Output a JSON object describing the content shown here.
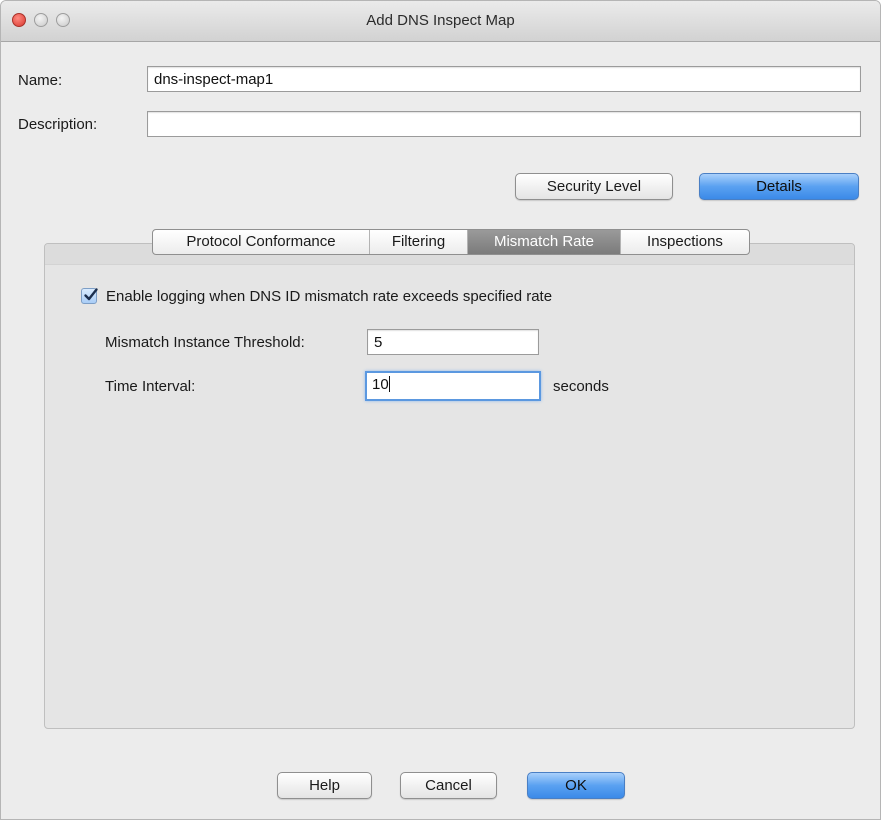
{
  "window": {
    "title": "Add DNS Inspect Map"
  },
  "form": {
    "name_label": "Name:",
    "name_value": "dns-inspect-map1",
    "description_label": "Description:",
    "description_value": ""
  },
  "view_buttons": {
    "security_level": "Security Level",
    "details": "Details"
  },
  "tabs": [
    {
      "label": "Protocol Conformance"
    },
    {
      "label": "Filtering"
    },
    {
      "label": "Mismatch Rate",
      "active": true
    },
    {
      "label": "Inspections"
    }
  ],
  "mismatch": {
    "enable_logging_label": "Enable logging when DNS ID mismatch rate exceeds specified rate",
    "enable_logging_checked": true,
    "threshold_label": "Mismatch Instance Threshold:",
    "threshold_value": "5",
    "interval_label": "Time Interval:",
    "interval_value": "10",
    "interval_unit": "seconds"
  },
  "footer": {
    "help": "Help",
    "cancel": "Cancel",
    "ok": "OK"
  }
}
